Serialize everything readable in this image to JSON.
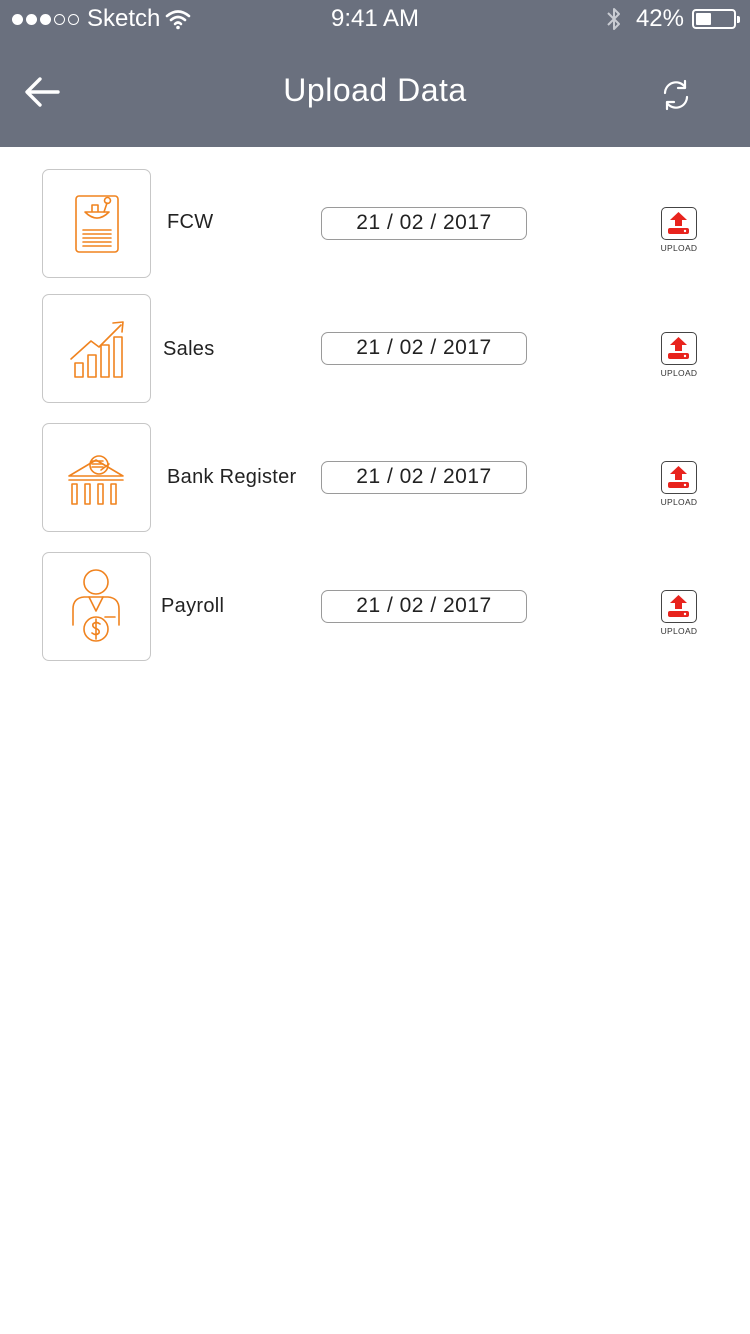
{
  "status_bar": {
    "carrier": "Sketch",
    "time": "9:41 AM",
    "battery": "42%",
    "battery_level": 0.42,
    "signal_bars": 3,
    "signal_total": 5
  },
  "header": {
    "title": "Upload Data",
    "back_icon": "arrow-left-icon",
    "refresh_icon": "refresh-icon",
    "background": "#6a707e"
  },
  "accent_color": "#f0831f",
  "upload_color": "#e8231d",
  "items": [
    {
      "label": "FCW",
      "date": "21 / 02 / 2017",
      "icon": "document-bowl-icon",
      "upload_label": "UPLOAD"
    },
    {
      "label": "Sales",
      "date": "21 / 02 / 2017",
      "icon": "growth-chart-icon",
      "upload_label": "UPLOAD"
    },
    {
      "label": "Bank Register",
      "date": "21 / 02 / 2017",
      "icon": "bank-icon",
      "upload_label": "UPLOAD"
    },
    {
      "label": "Payroll",
      "date": "21 / 02 / 2017",
      "icon": "person-dollar-icon",
      "upload_label": "UPLOAD"
    }
  ]
}
